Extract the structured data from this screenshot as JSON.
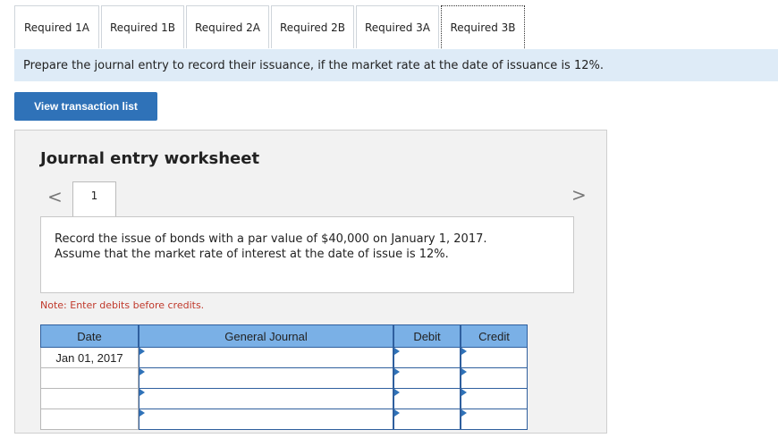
{
  "tabs": [
    "Required 1A",
    "Required 1B",
    "Required 2A",
    "Required 2B",
    "Required 3A",
    "Required 3B"
  ],
  "banner": "Prepare the journal entry to record their issuance, if the market rate at the date of issuance is 12%.",
  "view_button": "View transaction list",
  "worksheet": {
    "title": "Journal entry worksheet",
    "nav_prev": "<",
    "nav_next": ">",
    "page": "1",
    "description_line1": "Record the issue of bonds with a par value of $40,000 on January 1, 2017.",
    "description_line2": "Assume that the market rate of interest at the date of issue is 12%.",
    "note": "Note: Enter debits before credits."
  },
  "table": {
    "headers": [
      "Date",
      "General Journal",
      "Debit",
      "Credit"
    ],
    "rows": [
      {
        "date": "Jan 01, 2017"
      },
      {
        "date": ""
      },
      {
        "date": ""
      },
      {
        "date": ""
      }
    ]
  }
}
